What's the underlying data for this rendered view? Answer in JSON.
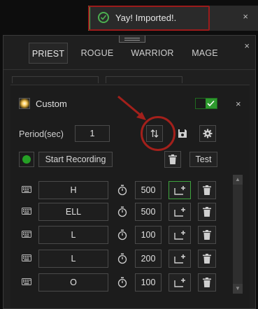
{
  "toast": {
    "message": "Yay! Imported!.",
    "close": "×"
  },
  "panel": {
    "close": "×"
  },
  "tabs": [
    {
      "label": "PRIEST",
      "active": true
    },
    {
      "label": "ROGUE",
      "active": false
    },
    {
      "label": "WARRIOR",
      "active": false
    },
    {
      "label": "MAGE",
      "active": false
    }
  ],
  "macro": {
    "name": "Custom",
    "enabled": true,
    "close": "×",
    "period_label": "Period(sec)",
    "period_value": "1",
    "start_recording_label": "Start Recording",
    "test_label": "Test"
  },
  "steps": [
    {
      "key": "H",
      "duration": "500",
      "selected": true
    },
    {
      "key": "ELL",
      "duration": "500",
      "selected": false
    },
    {
      "key": "L",
      "duration": "100",
      "selected": false
    },
    {
      "key": "L",
      "duration": "200",
      "selected": false
    },
    {
      "key": "O",
      "duration": "100",
      "selected": false
    }
  ],
  "colors": {
    "accent_green": "#2e9a2e",
    "annotation_red": "#a3201b"
  }
}
